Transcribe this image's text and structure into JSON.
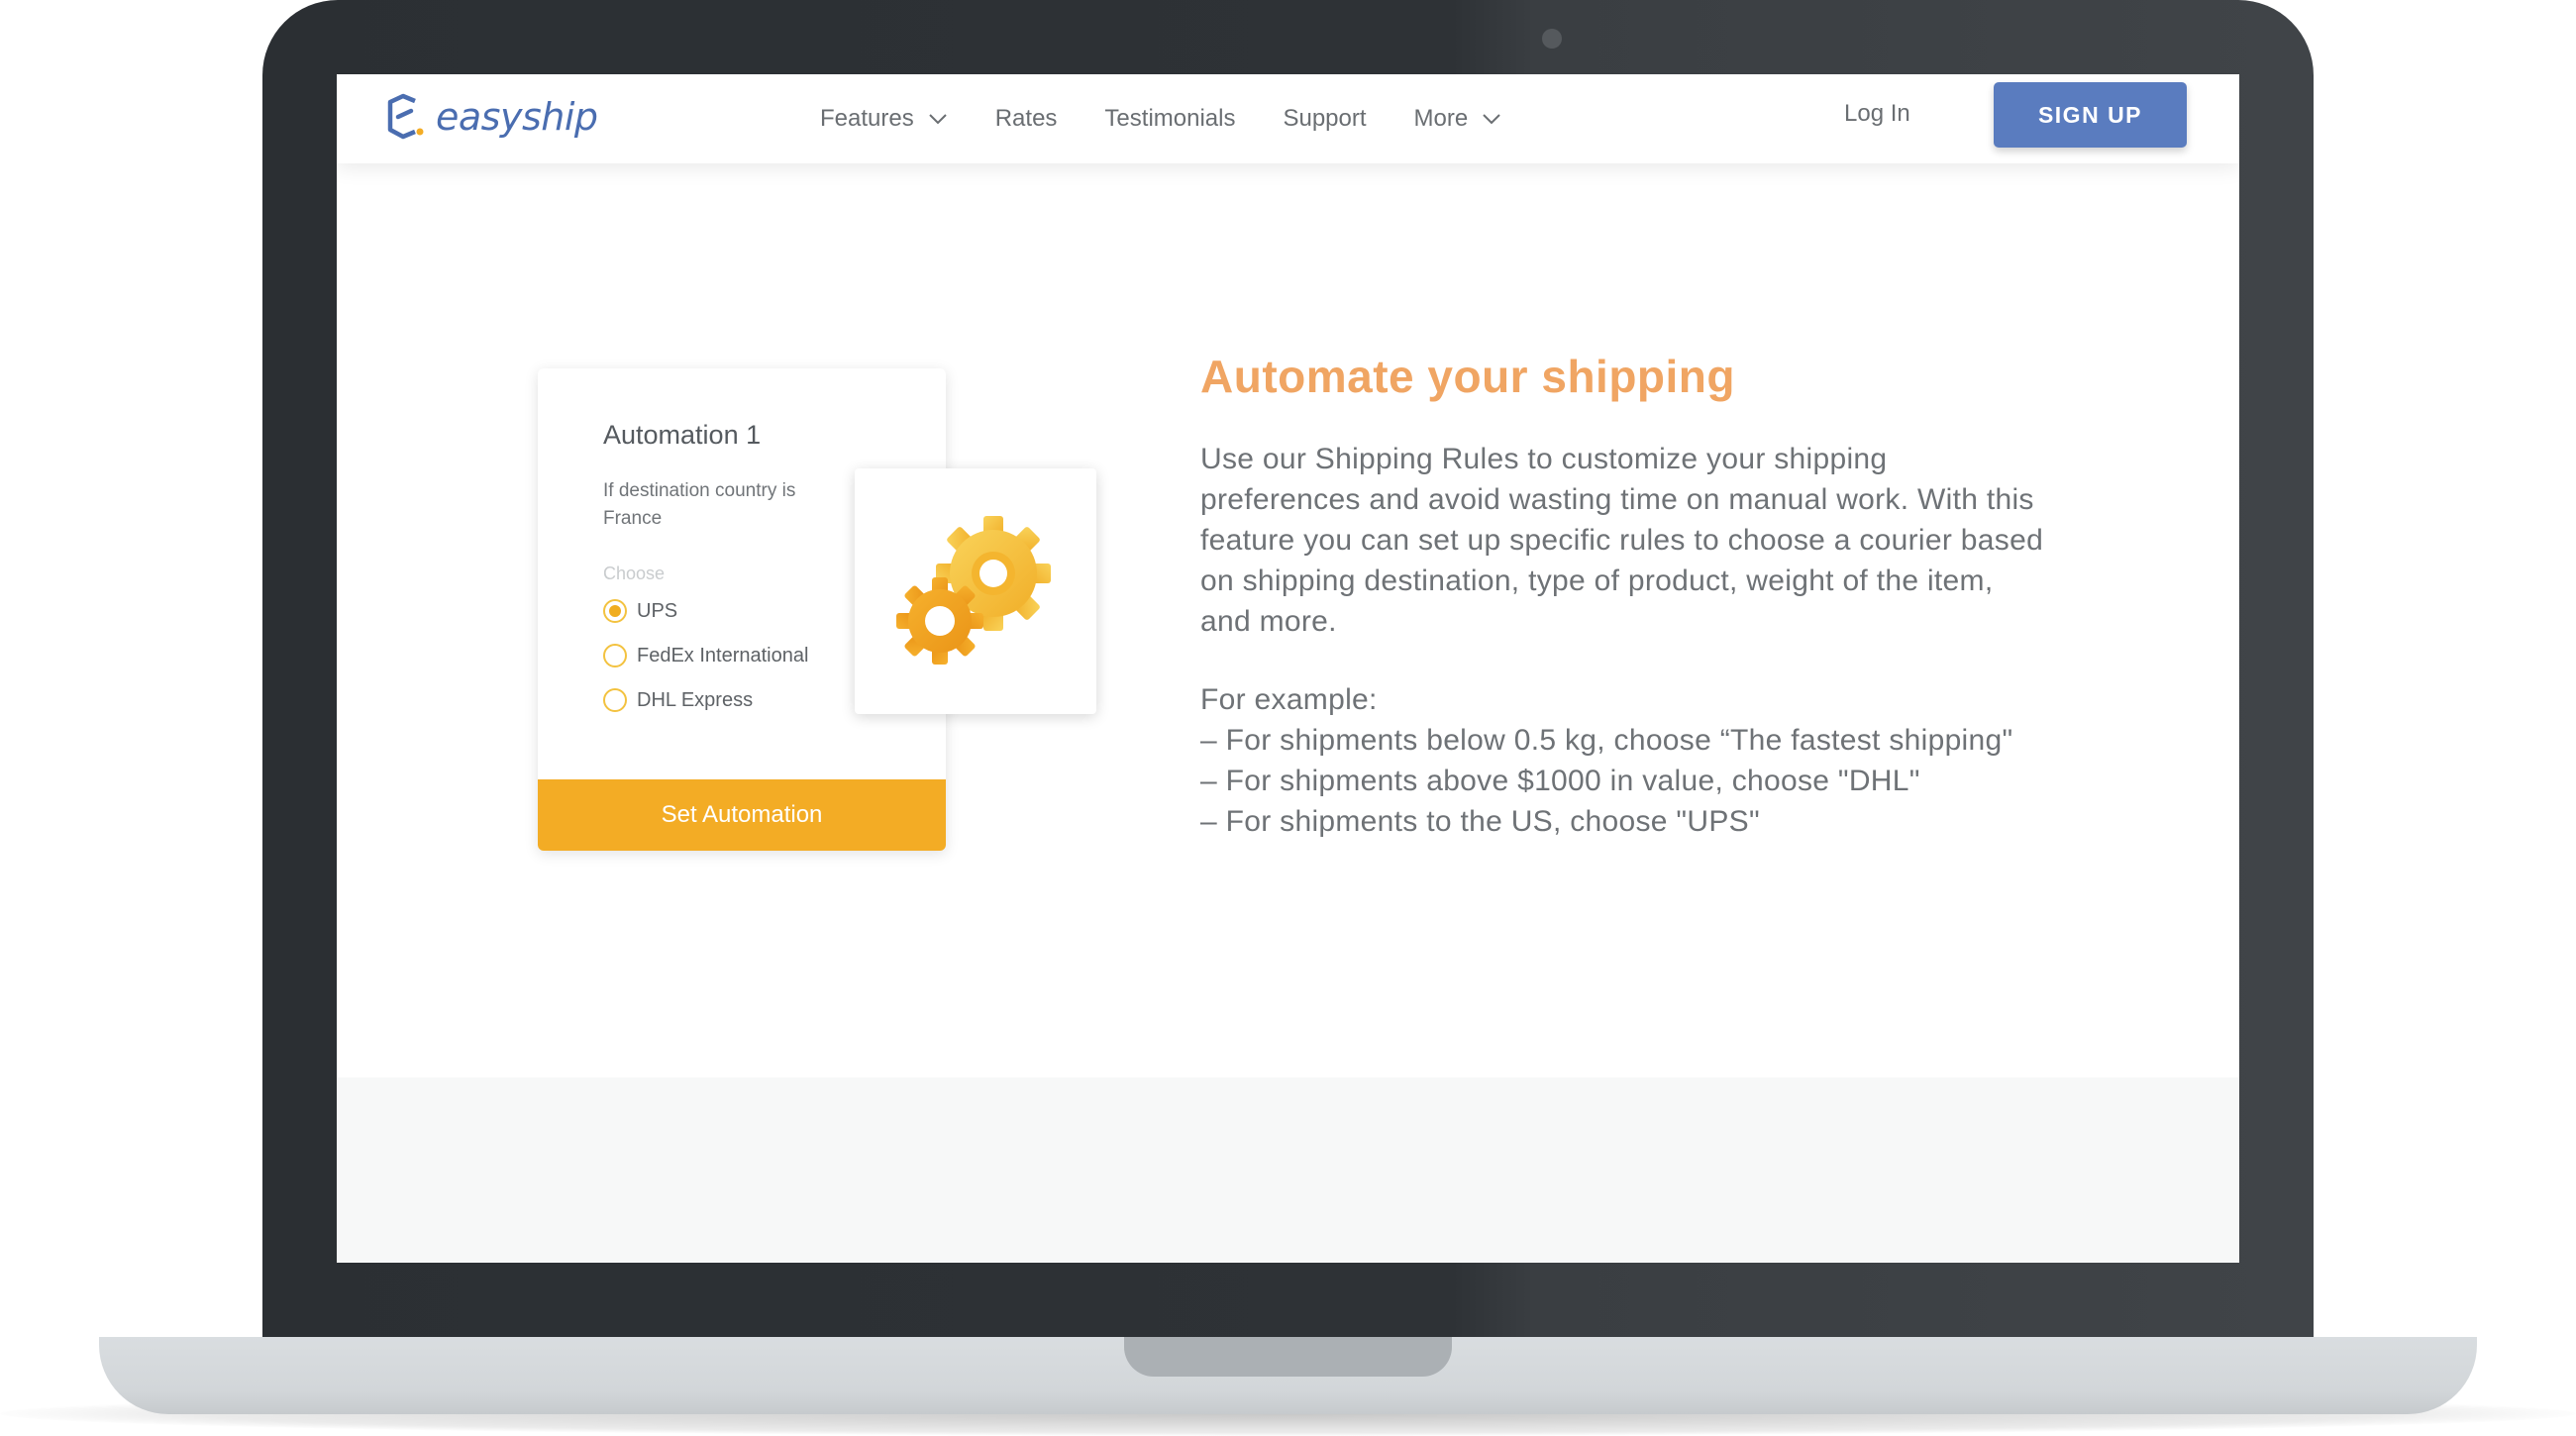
{
  "brand": {
    "name": "easyship",
    "accent": "#4a6db0"
  },
  "nav": {
    "items": [
      {
        "label": "Features",
        "dropdown": true
      },
      {
        "label": "Rates",
        "dropdown": false
      },
      {
        "label": "Testimonials",
        "dropdown": false
      },
      {
        "label": "Support",
        "dropdown": false
      },
      {
        "label": "More",
        "dropdown": true
      }
    ],
    "login_label": "Log In",
    "signup_label": "SIGN UP"
  },
  "automation_card": {
    "title": "Automation 1",
    "condition": "If destination country is France",
    "choose_label": "Choose",
    "options": [
      {
        "label": "UPS",
        "selected": true
      },
      {
        "label": "FedEx International",
        "selected": false
      },
      {
        "label": "DHL Express",
        "selected": false
      }
    ],
    "button_label": "Set Automation",
    "accent": "#f3ac25",
    "icon": "gears-icon"
  },
  "feature": {
    "headline": "Automate your shipping",
    "description": "Use our Shipping Rules to customize your shipping preferences and avoid wasting time on manual work. With this feature you can set up specific rules to choose a courier based on shipping destination, type of product, weight of the item, and more.",
    "examples_intro": "For example:",
    "examples": [
      "– For shipments below 0.5 kg, choose “The fastest shipping\"",
      "– For shipments above $1000 in value, choose \"DHL\"",
      "– For shipments to the US, choose \"UPS\""
    ],
    "headline_color": "#f0a563"
  }
}
